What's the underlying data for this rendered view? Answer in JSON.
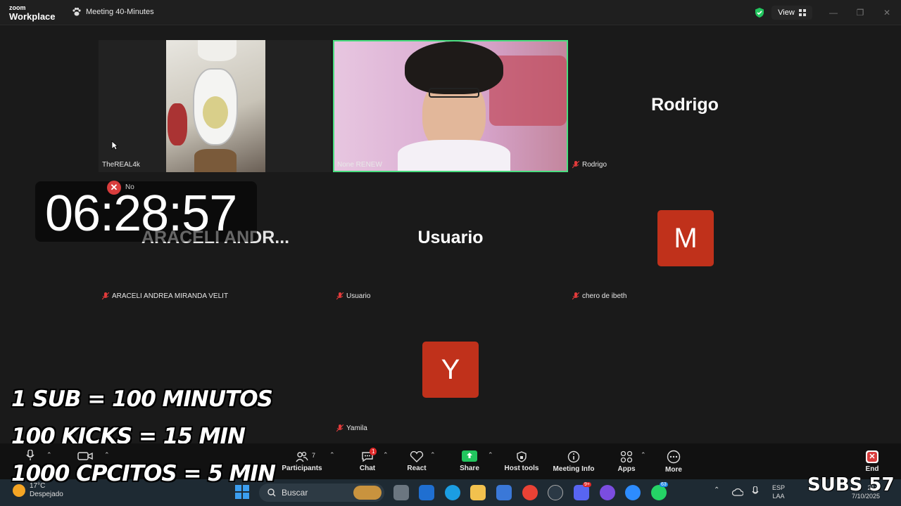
{
  "app": {
    "logo_line1": "zoom",
    "logo_line2": "Workplace",
    "meeting_title": "Meeting 40-Minutes",
    "view_label": "View"
  },
  "tiles": {
    "t1": {
      "label": "TheREAL4k"
    },
    "t2": {
      "label": "None RENEW"
    },
    "t3": {
      "big_name": "Rodrigo",
      "label": "Rodrigo"
    },
    "t4": {
      "big_name": "ARACELI  ANDR...",
      "label": "ARACELI ANDREA MIRANDA VELIT"
    },
    "t5": {
      "big_name": "Usuario",
      "label": "Usuario"
    },
    "t6": {
      "avatar": "M",
      "label": "chero de ibeth"
    },
    "t7": {
      "avatar": "Y",
      "label": "Yamila"
    }
  },
  "overlay": {
    "timer": "06:28:57",
    "no_label": "No",
    "promo1": "1 SUB = 100 MINUTOS",
    "promo2": "100 KICKS = 15 MIN",
    "promo3": "1000 CPCITOS = 5 MIN",
    "subs": "SUBS 57"
  },
  "toolbar": {
    "participants_label": "Participants",
    "participants_count": "7",
    "chat_label": "Chat",
    "chat_badge": "1",
    "react_label": "React",
    "share_label": "Share",
    "host_tools_label": "Host tools",
    "meeting_info_label": "Meeting Info",
    "apps_label": "Apps",
    "more_label": "More",
    "end_label": "End"
  },
  "taskbar": {
    "weather_temp": "17°C",
    "weather_desc": "Despejado",
    "search_placeholder": "Buscar",
    "discord_badge": "9+",
    "whatsapp_badge": "63",
    "lang1": "ESP",
    "lang2": "LAA",
    "time": "21:5",
    "date": "7/10/2025"
  },
  "colors": {
    "active_speaker": "#4ade80",
    "avatar_bg": "#c0311b",
    "share_green": "#22c55e",
    "end_red": "#d83c3c"
  }
}
